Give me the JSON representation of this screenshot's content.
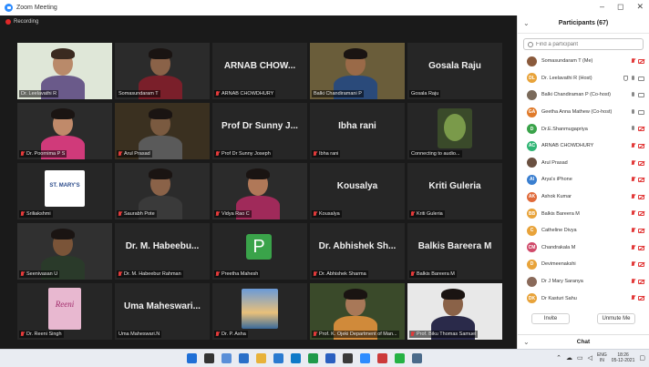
{
  "window": {
    "title": "Zoom Meeting",
    "controls": [
      "–",
      "◻",
      "✕"
    ]
  },
  "recording": {
    "label": "Recording"
  },
  "tiles": [
    {
      "name": "Dr. Leelavathi R",
      "big": "",
      "type": "video-woman",
      "muted": false,
      "active": false
    },
    {
      "name": "Somasundaram T",
      "big": "",
      "type": "video-man",
      "muted": false,
      "active": false
    },
    {
      "name": "ARNAB CHOWDHURY",
      "big": "ARNAB CHOW...",
      "type": "name",
      "muted": true,
      "active": false
    },
    {
      "name": "Balki Chandiramani P",
      "big": "",
      "type": "video-active",
      "muted": false,
      "active": true
    },
    {
      "name": "Gosala Raju",
      "big": "Gosala Raju",
      "type": "name",
      "muted": false,
      "active": false
    },
    {
      "name": "Dr. Poornima P S",
      "big": "",
      "type": "video-woman2",
      "muted": true,
      "active": false
    },
    {
      "name": "Arul Prasad",
      "big": "",
      "type": "video-man2",
      "muted": true,
      "active": false
    },
    {
      "name": "Prof Dr Sunny Joseph",
      "big": "Prof Dr Sunny J...",
      "type": "name",
      "muted": true,
      "active": false
    },
    {
      "name": "Ibha rani",
      "big": "Ibha rani",
      "type": "name",
      "muted": true,
      "active": false
    },
    {
      "name": "Connecting to audio...",
      "big": "",
      "type": "video-plant",
      "muted": false,
      "active": false
    },
    {
      "name": "Sriliakshmi",
      "big": "",
      "type": "logo-stmarys",
      "muted": true,
      "active": false
    },
    {
      "name": "Saurabh Pote",
      "big": "",
      "type": "video-man3",
      "muted": true,
      "active": false
    },
    {
      "name": "Vidya Rao C",
      "big": "",
      "type": "video-woman3",
      "muted": true,
      "active": false
    },
    {
      "name": "Kousalya",
      "big": "Kousalya",
      "type": "name",
      "muted": true,
      "active": false
    },
    {
      "name": "Kriti Guleria",
      "big": "Kriti Guleria",
      "type": "name",
      "muted": true,
      "active": false
    },
    {
      "name": "Seenivasan U",
      "big": "",
      "type": "video-man4",
      "muted": true,
      "active": false
    },
    {
      "name": "Dr. M. Habeebur Rahman",
      "big": "Dr. M. Habeebu...",
      "type": "name",
      "muted": true,
      "active": false
    },
    {
      "name": "Preetha Mahesh",
      "big": "",
      "type": "letter-p",
      "muted": true,
      "active": false
    },
    {
      "name": "Dr. Abhishek Sharma",
      "big": "Dr. Abhishek Sh...",
      "type": "name",
      "muted": true,
      "active": false
    },
    {
      "name": "Balkis Bareera M",
      "big": "Balkis Bareera M",
      "type": "name",
      "muted": true,
      "active": false
    },
    {
      "name": "Dr. Reeni Singh",
      "big": "",
      "type": "image-reeni",
      "muted": true,
      "active": false
    },
    {
      "name": "Uma Maheswari.N",
      "big": "Uma Maheswari...",
      "type": "name",
      "muted": false,
      "active": false
    },
    {
      "name": "Dr. P. Asha",
      "big": "",
      "type": "image-sea",
      "muted": true,
      "active": false
    },
    {
      "name": "Prof. K. Ojeki Department of Man...",
      "big": "",
      "type": "video-woman4",
      "muted": true,
      "active": false
    },
    {
      "name": "Prof. Biku Thomas Samuel",
      "big": "",
      "type": "video-man5",
      "muted": true,
      "active": false
    }
  ],
  "tile_art_text": {
    "stmarys": "ST. MARY'S",
    "reeni": "Reeni",
    "letter": "P"
  },
  "panel": {
    "title": "Participants (67)",
    "search_placeholder": "Find a participant",
    "participants": [
      {
        "name": "Somasundaram T (Me)",
        "initials": "",
        "color": "#8a5a3c",
        "mic": "off",
        "video": "off",
        "extra": false
      },
      {
        "name": "Dr. Leelavathi R (Host)",
        "initials": "DL",
        "color": "#e8a33a",
        "mic": "on",
        "video": "on",
        "extra": true
      },
      {
        "name": "Balki Chandiraman P (Co-host)",
        "initials": "",
        "color": "#7a6a5a",
        "mic": "on",
        "video": "on",
        "extra": false
      },
      {
        "name": "Geetha Anna Mathew (Co-host)",
        "initials": "GA",
        "color": "#e07a2a",
        "mic": "on",
        "video": "on",
        "extra": false
      },
      {
        "name": "Dr.E.Shanmugapriya",
        "initials": "D",
        "color": "#3aa34a",
        "mic": "on",
        "video": "off",
        "extra": false
      },
      {
        "name": "ARNAB CHOWDHURY",
        "initials": "AC",
        "color": "#2fb574",
        "mic": "off",
        "video": "off",
        "extra": false
      },
      {
        "name": "Arul Prasad",
        "initials": "",
        "color": "#6a5040",
        "mic": "off",
        "video": "off",
        "extra": false
      },
      {
        "name": "Arya's iPhone",
        "initials": "AI",
        "color": "#3a7fd0",
        "mic": "off",
        "video": "off",
        "extra": false
      },
      {
        "name": "Ashok Kumar",
        "initials": "AK",
        "color": "#e06a3a",
        "mic": "off",
        "video": "off",
        "extra": false
      },
      {
        "name": "Balkis Bareera M",
        "initials": "BB",
        "color": "#e8a33a",
        "mic": "off",
        "video": "off",
        "extra": false
      },
      {
        "name": "Catheline Divya",
        "initials": "C",
        "color": "#e8a33a",
        "mic": "off",
        "video": "off",
        "extra": false
      },
      {
        "name": "Chandrakala M",
        "initials": "CM",
        "color": "#d04a6a",
        "mic": "off",
        "video": "off",
        "extra": false
      },
      {
        "name": "Devimeenakshi",
        "initials": "D",
        "color": "#e8a33a",
        "mic": "off",
        "video": "off",
        "extra": false
      },
      {
        "name": "Dr J Mary Saranya",
        "initials": "",
        "color": "#8a6a5a",
        "mic": "off",
        "video": "off",
        "extra": false
      },
      {
        "name": "Dr Kasturi Sahu",
        "initials": "DK",
        "color": "#e8a33a",
        "mic": "off",
        "video": "off",
        "extra": false
      }
    ],
    "invite_label": "Invite",
    "unmute_label": "Unmute Me",
    "chat_label": "Chat"
  },
  "taskbar": {
    "icon_colors": [
      "#1f6fd6",
      "#333333",
      "#5a8fd8",
      "#2a6fc8",
      "#e8b23a",
      "#2a7ad0",
      "#0f7ac8",
      "#1f9a4a",
      "#2a5fc0",
      "#3a3a3a",
      "#2d8cff",
      "#cc3a3a",
      "#25b244",
      "#4a6a8a"
    ],
    "lang": "ENG",
    "region": "IN",
    "time": "18:26",
    "date": "05-12-2021"
  }
}
